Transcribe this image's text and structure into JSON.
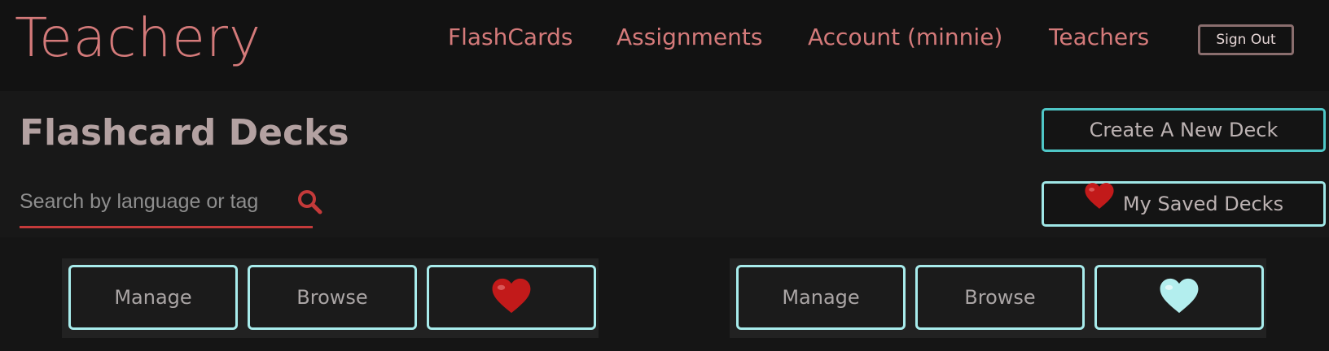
{
  "brand": "Teachery",
  "nav": {
    "flashcards": "FlashCards",
    "assignments": "Assignments",
    "account": "Account (minnie)",
    "teachers": "Teachers",
    "sign_out": "Sign Out"
  },
  "page": {
    "title": "Flashcard Decks",
    "search_placeholder": "Search by language or tag",
    "create_button": "Create A New Deck",
    "saved_button": "My Saved Decks"
  },
  "decks": [
    {
      "manage_label": "Manage",
      "browse_label": "Browse",
      "favorite_icon": "heart-filled-red",
      "favorite_color": "#c21a1a"
    },
    {
      "manage_label": "Manage",
      "browse_label": "Browse",
      "favorite_icon": "heart-filled-light-cyan",
      "favorite_color": "#b3eeee"
    }
  ],
  "colors": {
    "accent_brand": "#d47a7a",
    "accent_cyan": "#4fc6c6",
    "accent_light_cyan": "#a8ecec",
    "search_underline": "#c43a3a"
  }
}
